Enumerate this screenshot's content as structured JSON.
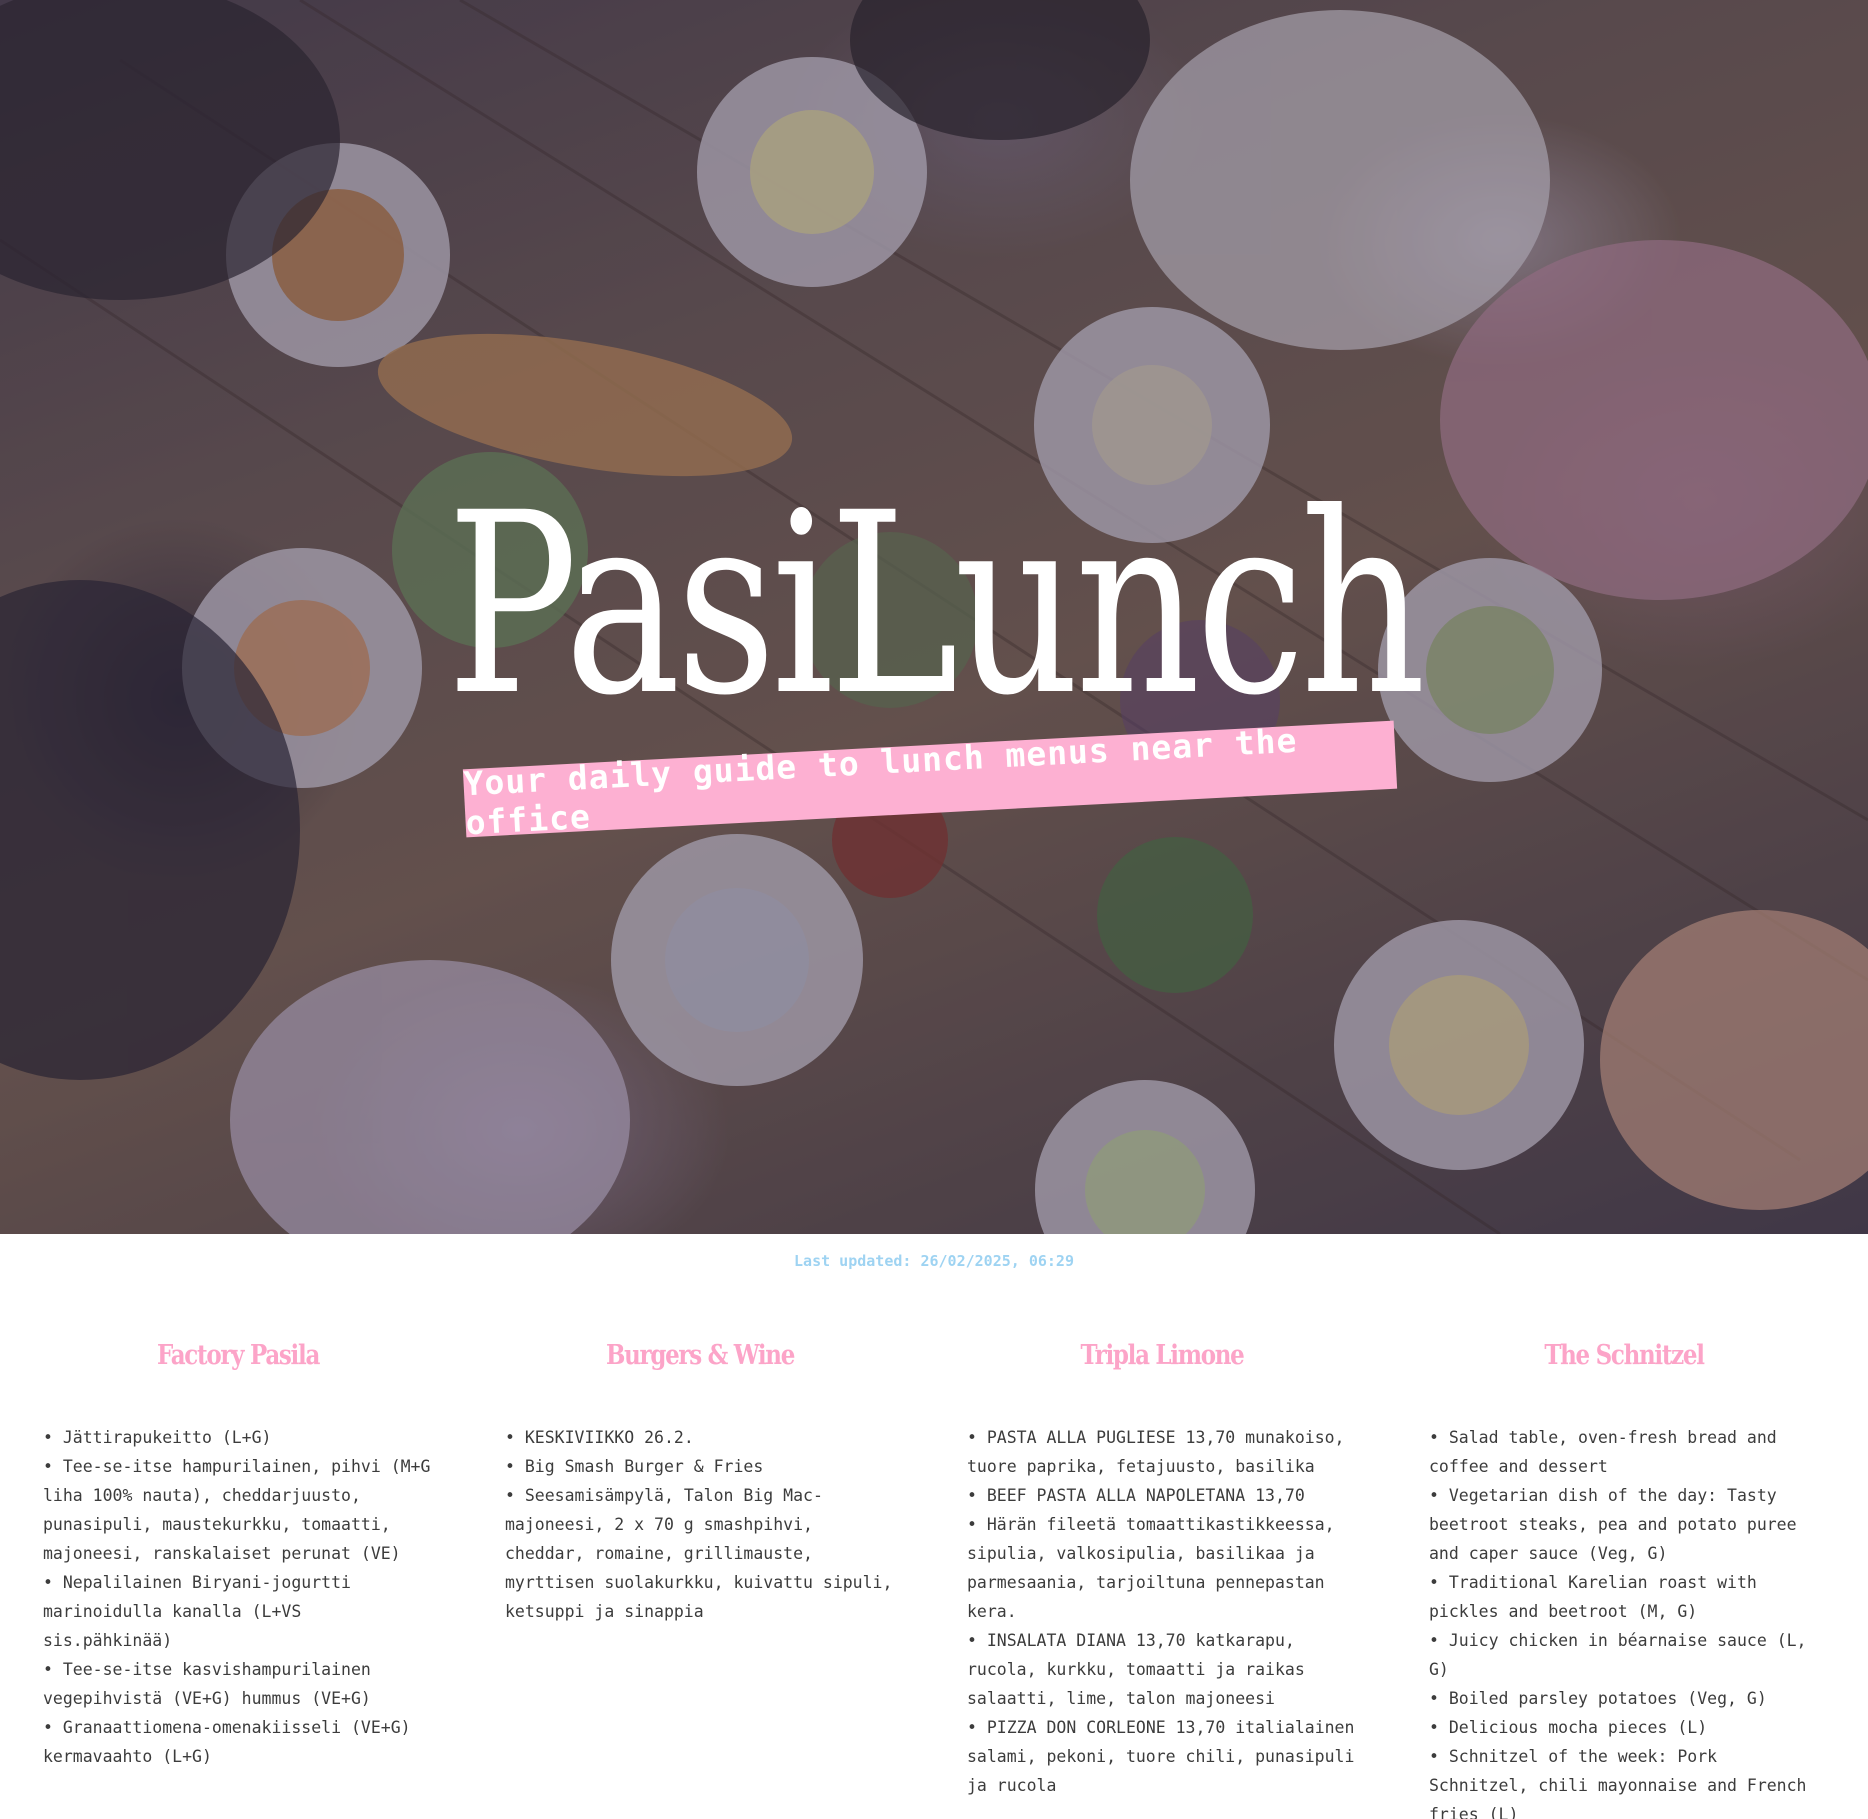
{
  "hero": {
    "title": "PasiLunch",
    "tagline": "Your daily guide to lunch menus near the office"
  },
  "last_updated": "Last updated: 26/02/2025, 06:29",
  "colors": {
    "accent_pink": "#fca4c8",
    "tagline_bg": "#fdb0d2",
    "updated_blue": "#9ed3f2",
    "body_text": "#3c3c3c"
  },
  "restaurants": [
    {
      "name": "Factory Pasila",
      "items": [
        "Jättirapukeitto (L+G)",
        "Tee-se-itse hampurilainen, pihvi (M+G liha 100% nauta), cheddarjuusto, punasipuli, maustekurkku, tomaatti, majoneesi, ranskalaiset perunat (VE)",
        "Nepalilainen Biryani-jogurtti marinoidulla kanalla (L+VS sis.pähkinää)",
        "Tee-se-itse kasvishampurilainen vegepihvistä (VE+G) hummus (VE+G)",
        "Granaattiomena-omenakiisseli (VE+G) kermavaahto (L+G)"
      ]
    },
    {
      "name": "Burgers & Wine",
      "items": [
        "KESKIVIIKKO 26.2.",
        "Big Smash Burger & Fries",
        "Seesamisämpylä, Talon Big Mac-majoneesi, 2 x 70 g smashpihvi, cheddar, romaine, grillimauste, myrttisen suolakurkku, kuivattu sipuli, ketsuppi ja sinappia"
      ]
    },
    {
      "name": "Tripla Limone",
      "items": [
        "PASTA ALLA PUGLIESE 13,70 munakoiso, tuore paprika, fetajuusto, basilika",
        "BEEF PASTA ALLA NAPOLETANA 13,70",
        "Härän fileetä tomaattikastikkeessa, sipulia, valkosipulia, basilikaa ja parmesaania, tarjoiltuna pennepastan kera.",
        "INSALATA DIANA 13,70 katkarapu, rucola, kurkku, tomaatti ja raikas salaatti, lime, talon majoneesi",
        "PIZZA DON CORLEONE 13,70 italialainen salami, pekoni, tuore chili, punasipuli ja rucola"
      ]
    },
    {
      "name": "The Schnitzel",
      "items": [
        "Salad table, oven-fresh bread and coffee and dessert",
        "Vegetarian dish of the day: Tasty beetroot steaks, pea and potato puree and caper sauce (Veg, G)",
        "Traditional Karelian roast with pickles and beetroot (M, G)",
        "Juicy chicken in béarnaise sauce (L, G)",
        "Boiled parsley potatoes (Veg, G)",
        "Delicious mocha pieces (L)",
        "Schnitzel of the week: Pork Schnitzel, chili mayonnaise and French fries (L)"
      ]
    }
  ]
}
